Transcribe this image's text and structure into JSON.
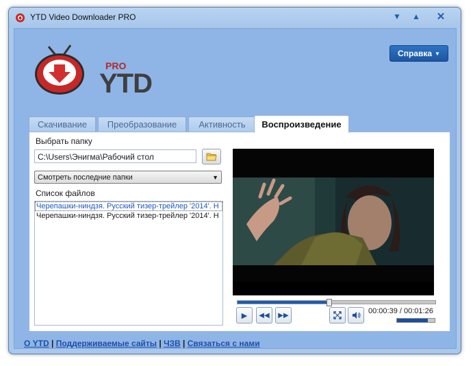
{
  "window": {
    "title": "YTD Video Downloader PRO"
  },
  "logo": {
    "pro": "PRO",
    "name": "YTD"
  },
  "help_button": {
    "label": "Справка"
  },
  "tabs": [
    {
      "label": "Скачивание",
      "active": false
    },
    {
      "label": "Преобразование",
      "active": false
    },
    {
      "label": "Активность",
      "active": false
    },
    {
      "label": "Воспроизведение",
      "active": true
    }
  ],
  "playback": {
    "folder_label": "Выбрать папку",
    "folder_path": "C:\\Users\\Энигма\\Рабочий стол",
    "recent_select": "Смотреть последние папки",
    "files_label": "Список файлов",
    "files": [
      "Черепашки-ниндзя. Русский тизер-трейлер '2014'. H",
      "Черепашки-ниндзя. Русский тизер-трейлер '2014'. H"
    ],
    "selected_file_index": 0,
    "progress": 0.46,
    "volume": 0.82,
    "time": "00:00:39 / 00:01:26"
  },
  "footer": {
    "about": "О YTD",
    "supported": "Поддерживаемые сайты",
    "faq": "ЧЗВ",
    "contact": "Связаться с нами",
    "sep": "|"
  },
  "colors": {
    "accent": "#1c56a4",
    "frame": "#a9c8ec",
    "client": "#8fb5e6"
  }
}
